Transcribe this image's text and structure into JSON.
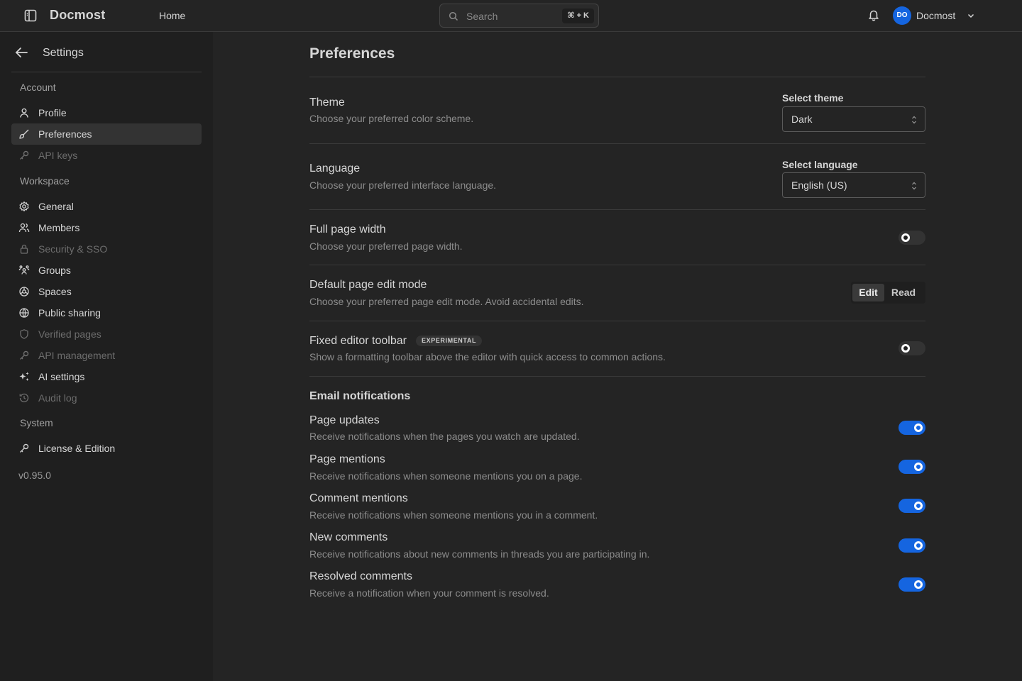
{
  "app": {
    "name": "Docmost"
  },
  "topbar": {
    "home_label": "Home",
    "search": {
      "placeholder": "Search",
      "shortcut": "⌘ + K"
    },
    "user": {
      "initials": "DO",
      "name": "Docmost"
    }
  },
  "sidebar": {
    "title": "Settings",
    "sections": {
      "account": "Account",
      "workspace": "Workspace",
      "system": "System"
    },
    "items": {
      "profile": "Profile",
      "preferences": "Preferences",
      "api_keys": "API keys",
      "general": "General",
      "members": "Members",
      "security": "Security & SSO",
      "groups": "Groups",
      "spaces": "Spaces",
      "public_sharing": "Public sharing",
      "verified_pages": "Verified pages",
      "api_management": "API management",
      "ai_settings": "AI settings",
      "audit_log": "Audit log",
      "license": "License & Edition"
    },
    "active_item": "Preferences",
    "version": "v0.95.0"
  },
  "main": {
    "title": "Preferences",
    "theme": {
      "title": "Theme",
      "description": "Choose your preferred color scheme.",
      "select_label": "Select theme",
      "value": "Dark"
    },
    "language": {
      "title": "Language",
      "description": "Choose your preferred interface language.",
      "select_label": "Select language",
      "value": "English (US)"
    },
    "full_width": {
      "title": "Full page width",
      "description": "Choose your preferred page width.",
      "enabled": false
    },
    "edit_mode": {
      "title": "Default page edit mode",
      "description": "Choose your preferred page edit mode. Avoid accidental edits.",
      "options": [
        "Edit",
        "Read"
      ],
      "selected": "Edit"
    },
    "fixed_toolbar": {
      "title": "Fixed editor toolbar",
      "badge": "EXPERIMENTAL",
      "description": "Show a formatting toolbar above the editor with quick access to common actions.",
      "enabled": false
    },
    "email": {
      "heading": "Email notifications",
      "items": [
        {
          "title": "Page updates",
          "description": "Receive notifications when the pages you watch are updated.",
          "enabled": true
        },
        {
          "title": "Page mentions",
          "description": "Receive notifications when someone mentions you on a page.",
          "enabled": true
        },
        {
          "title": "Comment mentions",
          "description": "Receive notifications when someone mentions you in a comment.",
          "enabled": true
        },
        {
          "title": "New comments",
          "description": "Receive notifications about new comments in threads you are participating in.",
          "enabled": true
        },
        {
          "title": "Resolved comments",
          "description": "Receive a notification when your comment is resolved.",
          "enabled": true
        }
      ]
    }
  },
  "colors": {
    "accent": "#1565e0",
    "background": "#242424",
    "sidebar": "#1f1f1f"
  }
}
